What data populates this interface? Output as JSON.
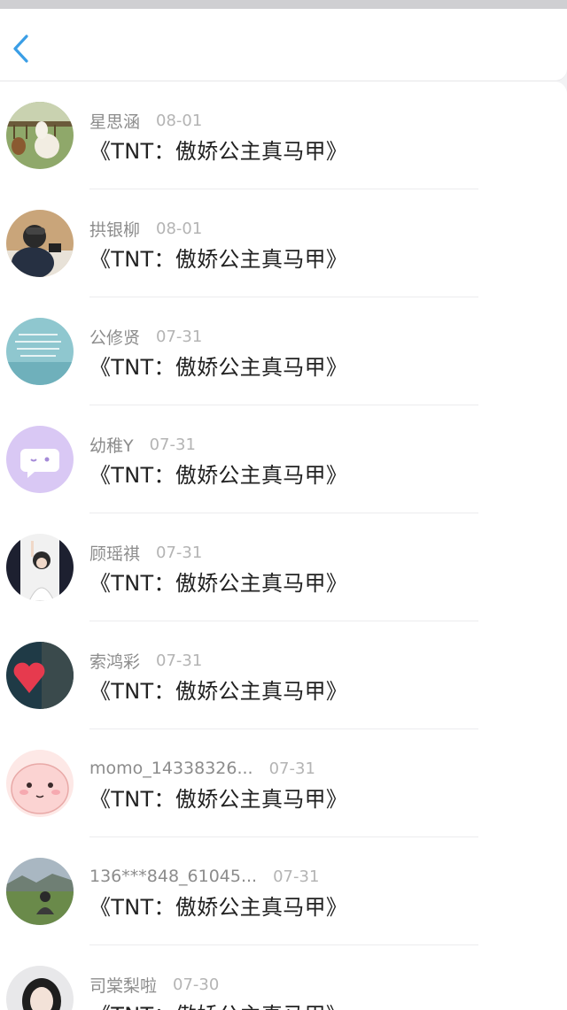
{
  "header": {
    "back_icon": "chevron-left-icon",
    "accent": "#3a9ee6"
  },
  "items": [
    {
      "name": "星思涵",
      "date": "08-01",
      "title": "《TNT：傲娇公主真马甲》"
    },
    {
      "name": "拱银柳",
      "date": "08-01",
      "title": "《TNT：傲娇公主真马甲》"
    },
    {
      "name": "公修贤",
      "date": "07-31",
      "title": "《TNT：傲娇公主真马甲》"
    },
    {
      "name": "幼稚Y",
      "date": "07-31",
      "title": "《TNT：傲娇公主真马甲》"
    },
    {
      "name": "顾瑶祺",
      "date": "07-31",
      "title": "《TNT：傲娇公主真马甲》"
    },
    {
      "name": "索鸿彩",
      "date": "07-31",
      "title": "《TNT：傲娇公主真马甲》"
    },
    {
      "name": "momo_14338326...",
      "date": "07-31",
      "title": "《TNT：傲娇公主真马甲》"
    },
    {
      "name": "136***848_61045...",
      "date": "07-31",
      "title": "《TNT：傲娇公主真马甲》"
    },
    {
      "name": "司棠梨啦",
      "date": "07-30",
      "title": "《TNT：傲娇公主真马甲》"
    }
  ]
}
